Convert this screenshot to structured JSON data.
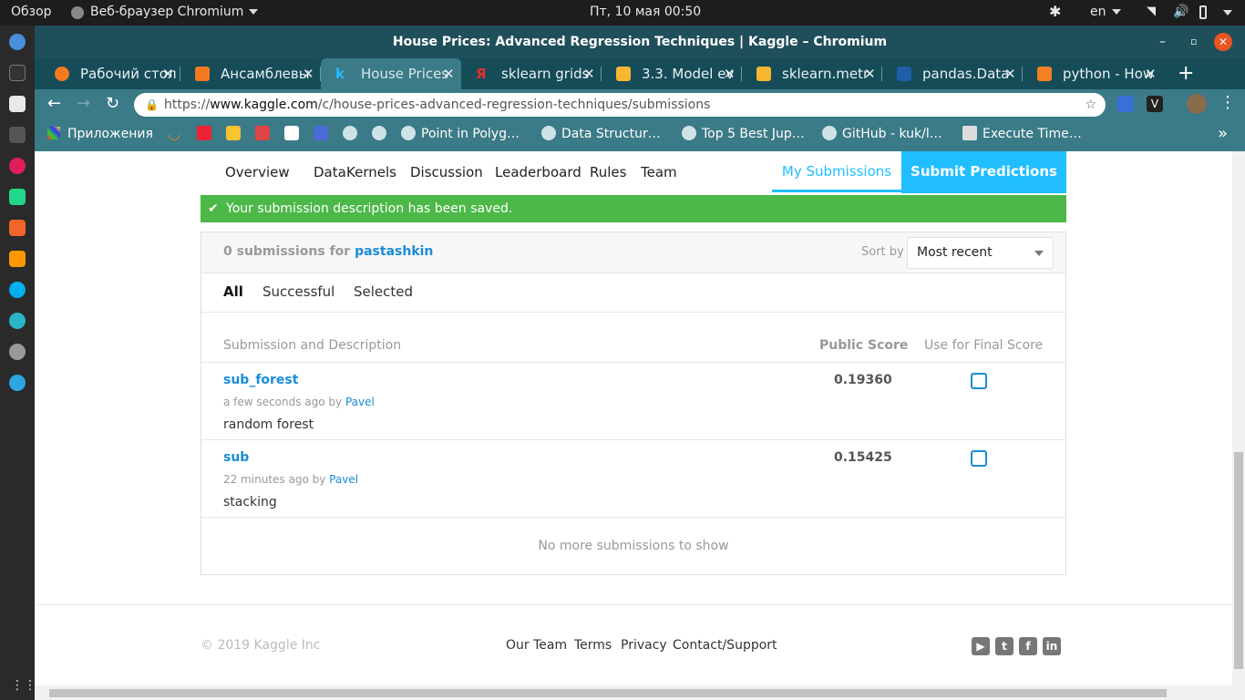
{
  "system": {
    "activities": "Обзор",
    "app_name": "Веб-браузер Chromium",
    "clock": "Пт, 10 мая  00:50",
    "lang": "en"
  },
  "window": {
    "title": "House Prices: Advanced Regression Techniques | Kaggle – Chromium"
  },
  "tabs": [
    {
      "label": "Рабочий стол",
      "color": "#f37a1f"
    },
    {
      "label": "Ансамблевы",
      "color": "#f37a1f"
    },
    {
      "label": "House Prices",
      "color": "#20beff"
    },
    {
      "label": "sklearn grids",
      "color": "#e62e2e"
    },
    {
      "label": "3.3. Model ev",
      "color": "#f7b731"
    },
    {
      "label": "sklearn.metr",
      "color": "#f7b731"
    },
    {
      "label": "pandas.Data",
      "color": "#1f5fa8"
    },
    {
      "label": "python - How",
      "color": "#f48024"
    }
  ],
  "address": {
    "scheme": "https://",
    "host": "www.kaggle.com",
    "path": "/c/house-prices-advanced-regression-techniques/submissions"
  },
  "bookmarks": {
    "apps": "Приложения",
    "items": [
      "Point in Polyg…",
      "Data Structur…",
      "Top 5 Best Jup…",
      "GitHub - kuk/l…",
      "Execute Time…"
    ],
    "more": "»"
  },
  "nav": {
    "items": [
      "Overview",
      "Data",
      "Kernels",
      "Discussion",
      "Leaderboard",
      "Rules",
      "Team"
    ],
    "my_submissions": "My Submissions",
    "submit": "Submit Predictions"
  },
  "alert": {
    "message": "Your submission description has been saved."
  },
  "submissions": {
    "count_text": "0 submissions for",
    "user": "pastashkin",
    "sort_label": "Sort by",
    "sort_value": "Most recent",
    "filters": [
      "All",
      "Successful",
      "Selected"
    ],
    "columns": {
      "description": "Submission and Description",
      "public": "Public Score",
      "final": "Use for Final Score"
    },
    "rows": [
      {
        "name": "sub_forest",
        "time": "a few seconds ago by",
        "author": "Pavel",
        "desc": "random forest",
        "score": "0.19360"
      },
      {
        "name": "sub",
        "time": "22 minutes ago by",
        "author": "Pavel",
        "desc": "stacking",
        "score": "0.15425"
      }
    ],
    "empty_note": "No more submissions to show"
  },
  "footer": {
    "copyright": "© 2019 Kaggle Inc",
    "links": [
      "Our Team",
      "Terms",
      "Privacy",
      "Contact/Support"
    ]
  }
}
